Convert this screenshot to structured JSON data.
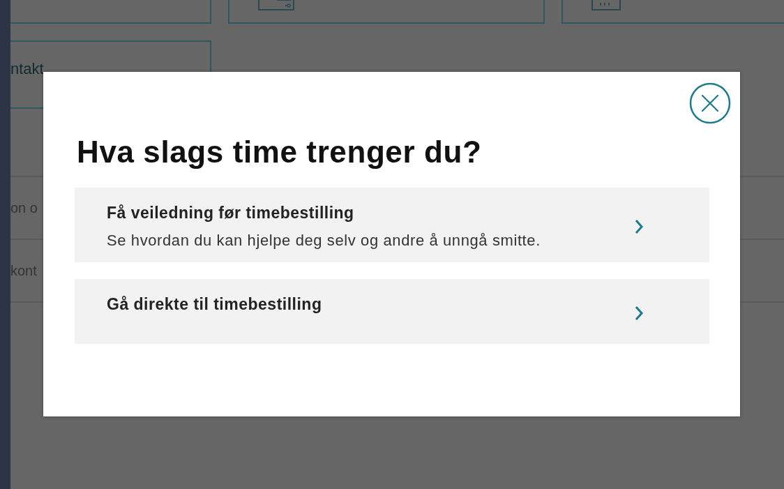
{
  "background": {
    "card_label": "ntakt",
    "row_labels": [
      "on o",
      "kont"
    ]
  },
  "dialog": {
    "title": "Hva slags time trenger du?",
    "options": [
      {
        "title": "Få veiledning før timebestilling",
        "description": "Se hvordan du kan hjelpe deg selv og andre å unngå smitte."
      },
      {
        "title": "Gå direkte til timebestilling"
      }
    ]
  }
}
